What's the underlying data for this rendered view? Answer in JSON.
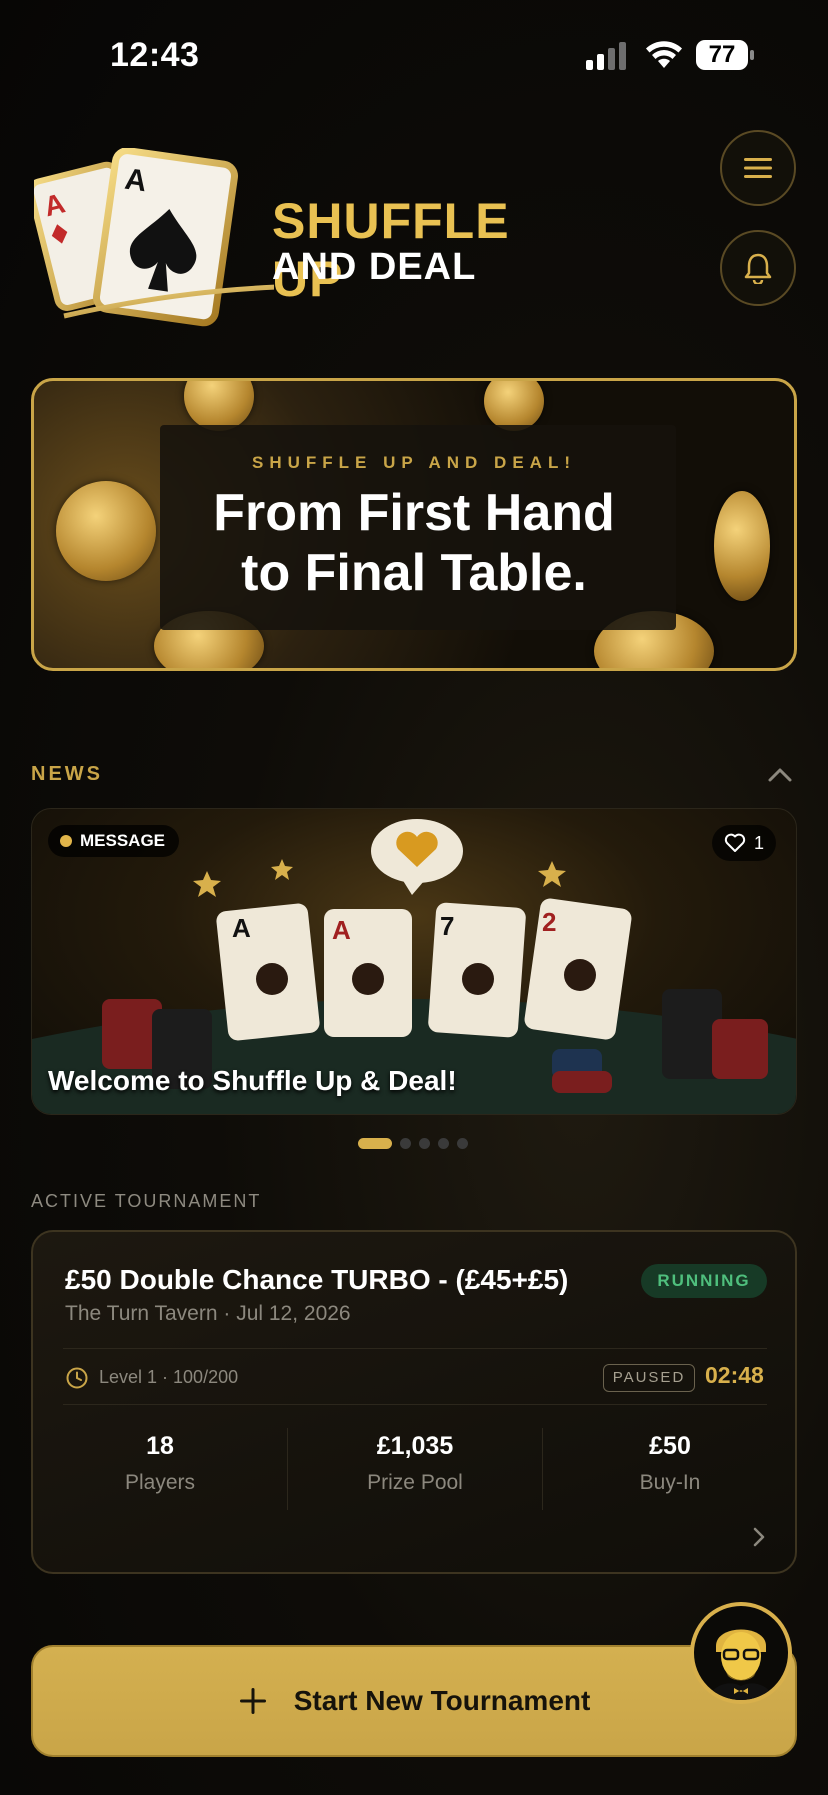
{
  "status_bar": {
    "time": "12:43",
    "battery": "77"
  },
  "logo": {
    "title_line1": "SHUFFLE UP",
    "title_line2": "AND DEAL",
    "card_rank": "A"
  },
  "hero": {
    "kicker": "SHUFFLE UP AND DEAL!",
    "line1": "From First Hand",
    "line2": "to Final Table."
  },
  "news": {
    "header": "NEWS",
    "card": {
      "badge": "MESSAGE",
      "likes": "1",
      "title": "Welcome to Shuffle Up & Deal!"
    },
    "carousel_total": 5,
    "carousel_active": 1
  },
  "active_tournament": {
    "section_label": "ACTIVE TOURNAMENT",
    "title": "£50 Double Chance TURBO - (£45+£5)",
    "subtitle": "The Turn Tavern · Jul 12, 2026",
    "status": "RUNNING",
    "level": "Level 1 · 100/200",
    "clock_state": "PAUSED",
    "timer": "02:48",
    "stats": [
      {
        "value": "18",
        "label": "Players"
      },
      {
        "value": "£1,035",
        "label": "Prize Pool"
      },
      {
        "value": "£50",
        "label": "Buy-In"
      }
    ]
  },
  "cta": {
    "label": "Start New Tournament"
  },
  "colors": {
    "accent_gold": "#c9a548",
    "running_green": "#4fbf7d",
    "background": "#0e0c08"
  }
}
